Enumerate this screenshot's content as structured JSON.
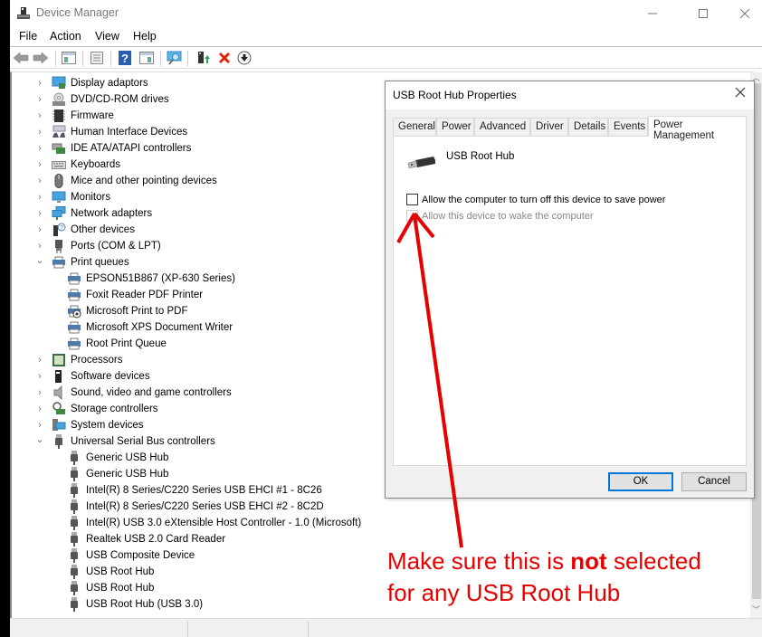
{
  "window": {
    "title": "Device Manager",
    "controls": {
      "minimize": "—",
      "maximize": "☐",
      "close": "✕"
    }
  },
  "menu": [
    "File",
    "Action",
    "View",
    "Help"
  ],
  "toolbar": [
    {
      "name": "back-icon"
    },
    {
      "name": "forward-icon"
    },
    {
      "name": "show-hide-console-tree-icon"
    },
    {
      "name": "properties-icon"
    },
    {
      "name": "help-icon"
    },
    {
      "name": "action-pane-icon"
    },
    {
      "name": "scan-hardware-icon"
    },
    {
      "name": "update-driver-icon"
    },
    {
      "name": "uninstall-icon"
    },
    {
      "name": "disable-device-icon"
    }
  ],
  "tree": [
    {
      "label": "Display adaptors",
      "icon": "display-adapter-icon",
      "expanded": false,
      "level": 0
    },
    {
      "label": "DVD/CD-ROM drives",
      "icon": "dvd-drive-icon",
      "expanded": false,
      "level": 0
    },
    {
      "label": "Firmware",
      "icon": "firmware-chip-icon",
      "expanded": false,
      "level": 0
    },
    {
      "label": "Human Interface Devices",
      "icon": "hid-icon",
      "expanded": false,
      "level": 0
    },
    {
      "label": "IDE ATA/ATAPI controllers",
      "icon": "ide-controller-icon",
      "expanded": false,
      "level": 0
    },
    {
      "label": "Keyboards",
      "icon": "keyboard-icon",
      "expanded": false,
      "level": 0
    },
    {
      "label": "Mice and other pointing devices",
      "icon": "mouse-icon",
      "expanded": false,
      "level": 0
    },
    {
      "label": "Monitors",
      "icon": "monitor-icon",
      "expanded": false,
      "level": 0
    },
    {
      "label": "Network adapters",
      "icon": "network-adapter-icon",
      "expanded": false,
      "level": 0
    },
    {
      "label": "Other devices",
      "icon": "unknown-device-icon",
      "expanded": false,
      "level": 0
    },
    {
      "label": "Ports (COM & LPT)",
      "icon": "port-icon",
      "expanded": false,
      "level": 0
    },
    {
      "label": "Print queues",
      "icon": "printer-icon",
      "expanded": true,
      "level": 0
    },
    {
      "label": "EPSON51B867 (XP-630 Series)",
      "icon": "printer-icon",
      "level": 1
    },
    {
      "label": "Foxit Reader PDF Printer",
      "icon": "printer-icon",
      "level": 1
    },
    {
      "label": "Microsoft Print to PDF",
      "icon": "printer-default-icon",
      "level": 1
    },
    {
      "label": "Microsoft XPS Document Writer",
      "icon": "printer-icon",
      "level": 1
    },
    {
      "label": "Root Print Queue",
      "icon": "printer-icon",
      "level": 1
    },
    {
      "label": "Processors",
      "icon": "processor-icon",
      "expanded": false,
      "level": 0
    },
    {
      "label": "Software devices",
      "icon": "software-device-icon",
      "expanded": false,
      "level": 0
    },
    {
      "label": "Sound, video and game controllers",
      "icon": "speaker-icon",
      "expanded": false,
      "level": 0
    },
    {
      "label": "Storage controllers",
      "icon": "storage-controller-icon",
      "expanded": false,
      "level": 0
    },
    {
      "label": "System devices",
      "icon": "system-devices-icon",
      "expanded": false,
      "level": 0
    },
    {
      "label": "Universal Serial Bus controllers",
      "icon": "usb-icon",
      "expanded": true,
      "level": 0
    },
    {
      "label": "Generic USB Hub",
      "icon": "usb-icon",
      "level": 1
    },
    {
      "label": "Generic USB Hub",
      "icon": "usb-icon",
      "level": 1
    },
    {
      "label": "Intel(R) 8 Series/C220 Series USB EHCI #1 - 8C26",
      "icon": "usb-icon",
      "level": 1
    },
    {
      "label": "Intel(R) 8 Series/C220 Series USB EHCI #2 - 8C2D",
      "icon": "usb-icon",
      "level": 1
    },
    {
      "label": "Intel(R) USB 3.0 eXtensible Host Controller - 1.0 (Microsoft)",
      "icon": "usb-icon",
      "level": 1
    },
    {
      "label": "Realtek USB 2.0 Card Reader",
      "icon": "usb-icon",
      "level": 1
    },
    {
      "label": "USB Composite Device",
      "icon": "usb-icon",
      "level": 1
    },
    {
      "label": "USB Root Hub",
      "icon": "usb-icon",
      "level": 1
    },
    {
      "label": "USB Root Hub",
      "icon": "usb-icon",
      "level": 1
    },
    {
      "label": "USB Root Hub (USB 3.0)",
      "icon": "usb-icon",
      "level": 1
    }
  ],
  "dialog": {
    "title": "USB Root Hub Properties",
    "close": "✕",
    "tabs": [
      "General",
      "Power",
      "Advanced",
      "Driver",
      "Details",
      "Events",
      "Power Management"
    ],
    "active_tab": "Power Management",
    "device_name": "USB Root Hub",
    "options": [
      {
        "label": "Allow the computer to turn off this device to save power",
        "checked": false,
        "enabled": true
      },
      {
        "label": "Allow this device to wake the computer",
        "checked": false,
        "enabled": false
      }
    ],
    "ok_label": "OK",
    "cancel_label": "Cancel"
  },
  "annotation": {
    "line1_pre": "Make sure this is ",
    "line1_bold": "not",
    "line1_post": " selected",
    "line2": "for any USB Root Hub",
    "color": "#e60000"
  }
}
